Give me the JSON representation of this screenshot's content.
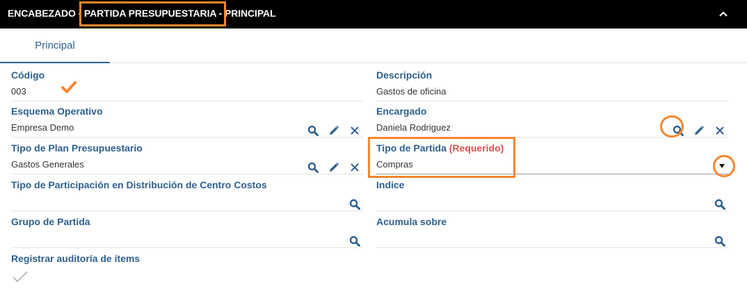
{
  "header": {
    "title_prefix": "ENCABEZADO - ",
    "title_highlight": "PARTIDA PRESUPUESTARIA -",
    "title_suffix": " PRINCIPAL",
    "collapse_icon": "chevron-up-icon"
  },
  "tabs": [
    {
      "label": "Principal",
      "active": true
    }
  ],
  "fields": {
    "codigo": {
      "label": "Código",
      "value": "003"
    },
    "descripcion": {
      "label": "Descripción",
      "value": "Gastos de oficina"
    },
    "esquema": {
      "label": "Esquema Operativo",
      "value": "Empresa Demo"
    },
    "encargado": {
      "label": "Encargado",
      "value": "Daniela Rodriguez"
    },
    "tipo_plan": {
      "label": "Tipo de Plan Presupuestario",
      "value": "Gastos Generales"
    },
    "tipo_partida": {
      "label": "Tipo de Partida",
      "required": "(Requerido)",
      "value": "Compras"
    },
    "tipo_participacion": {
      "label": "Tipo de Participación en Distribución de Centro Costos",
      "value": ""
    },
    "indice": {
      "label": "Indice",
      "value": ""
    },
    "grupo": {
      "label": "Grupo de Partida",
      "value": ""
    },
    "acumula": {
      "label": "Acumula sobre",
      "value": ""
    },
    "auditoria": {
      "label": "Registrar auditoría de ítems",
      "checked": true
    }
  },
  "colors": {
    "accent": "#2d5f8f",
    "highlight": "#f5852d",
    "required": "#d9534f",
    "header_bg": "#000000"
  },
  "icons": [
    "search-icon",
    "edit-icon",
    "clear-icon",
    "dropdown-icon",
    "checkmark-icon"
  ]
}
